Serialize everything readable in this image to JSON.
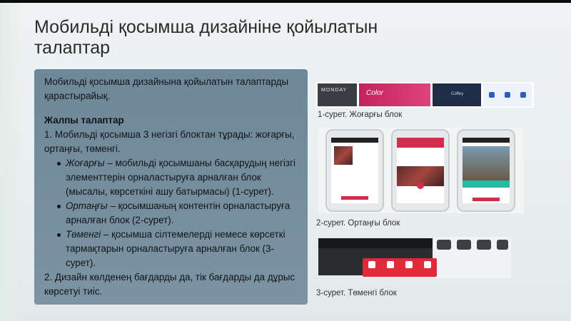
{
  "slide": {
    "title": "Мобильді қосымша дизайніне қойылатын талаптар",
    "intro": "Мобильді қосымша дизайнына қойылатын талаптарды қарастырайық.",
    "heading": "Жалпы талаптар",
    "point1": "1. Мобильді қосымша 3 негізгі блоктан тұрады: жоғарғы, ортаңғы, төменгі.",
    "sub": [
      {
        "term": "Жоғарғы",
        "text": " – мобильді қосымшаны басқарудың негізгі элементтерін орналастыруға арналған блок (мысалы, көрсеткіні ашу батырмасы) (1-сурет)."
      },
      {
        "term": "Ортаңғы",
        "text": " – қосымшаның контентін орналастыруға арналған блок (2-сурет)."
      },
      {
        "term": "Төменгі",
        "text": " – қосымша сілтемелерді немесе көрсеткі тармақтарын орналастыруға арналған блок (3-сурет)."
      }
    ],
    "point2": "2. Дизайн көлденең бағдарды да, тік бағдарды да дұрыс көрсетуі тиіс."
  },
  "figures": {
    "fig1_caption": "1-сурет. Жоғарғы блок",
    "fig2_caption": "2-сурет. Ортаңғы блок",
    "fig3_caption": "3-сурет. Төменгі блок",
    "fig1_texts": [
      "MONDAY",
      "Color",
      "Coffey"
    ]
  },
  "colors": {
    "title": "#2a2a2a",
    "text_box": "#7389998",
    "accent_red": "#e02a3c"
  }
}
